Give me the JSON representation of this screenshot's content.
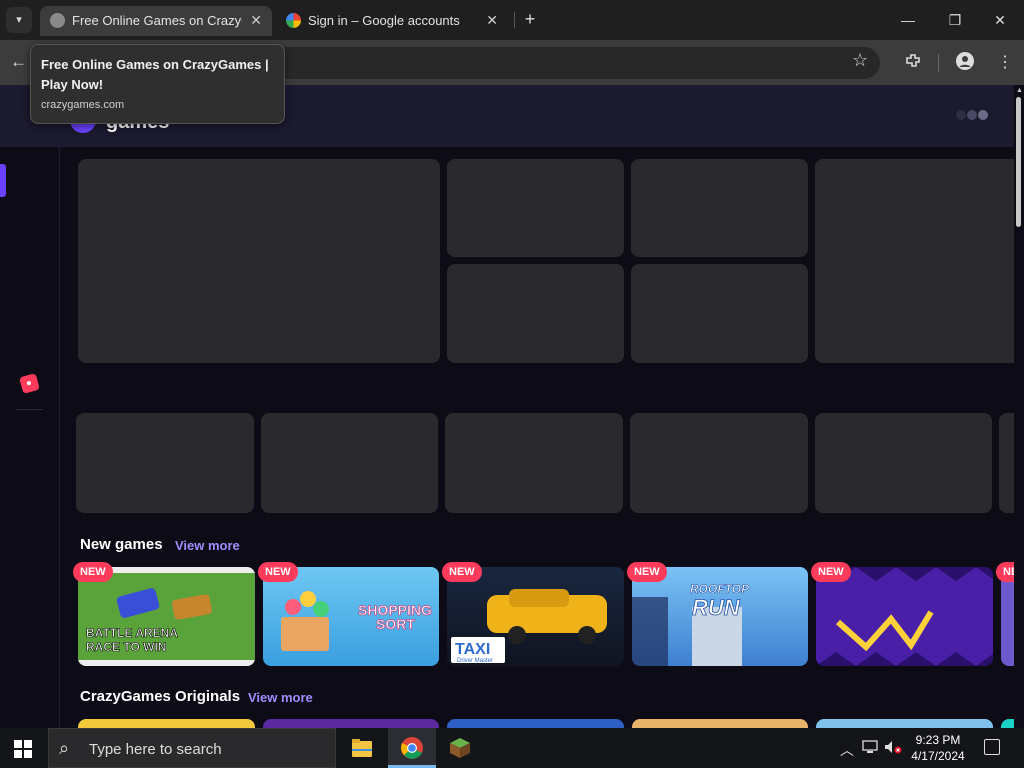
{
  "browser": {
    "tabs": [
      {
        "title": "Free Online Games on CrazyGames",
        "close": "✕",
        "active": true
      },
      {
        "title": "Sign in – Google accounts",
        "close": "✕",
        "active": false
      }
    ],
    "new_tab": "+",
    "window_controls": {
      "minimize": "—",
      "restore": "❐",
      "close": "✕"
    },
    "tooltip": {
      "title": "Free Online Games on CrazyGames | Play Now!",
      "url": "crazygames.com"
    }
  },
  "site": {
    "logo_text": "games",
    "sections": [
      {
        "title": "New games",
        "view_more": "View more"
      },
      {
        "title": "CrazyGames Originals",
        "view_more": "View more"
      }
    ],
    "new_games": [
      {
        "badge": "NEW",
        "caption_line1": "BATTLE ARENA",
        "caption_line2": "RACE TO WIN"
      },
      {
        "badge": "NEW",
        "caption_line1": "SHOPPING",
        "caption_line2": "SORT"
      },
      {
        "badge": "NEW",
        "caption_line1": "TAXI",
        "caption_line2": "Driver Master"
      },
      {
        "badge": "NEW",
        "caption_line1": "ROOFTOP",
        "caption_line2": "RUN"
      },
      {
        "badge": "NEW",
        "caption_line1": "",
        "caption_line2": ""
      },
      {
        "badge": "NE",
        "caption_line1": "",
        "caption_line2": ""
      }
    ]
  },
  "taskbar": {
    "search_placeholder": "Type here to search",
    "time": "9:23 PM",
    "date": "4/17/2024"
  },
  "colors": {
    "accent": "#6842ff",
    "new_badge": "#ff3b5c",
    "link": "#a08cff",
    "placeholder": "#2a2a2e"
  }
}
